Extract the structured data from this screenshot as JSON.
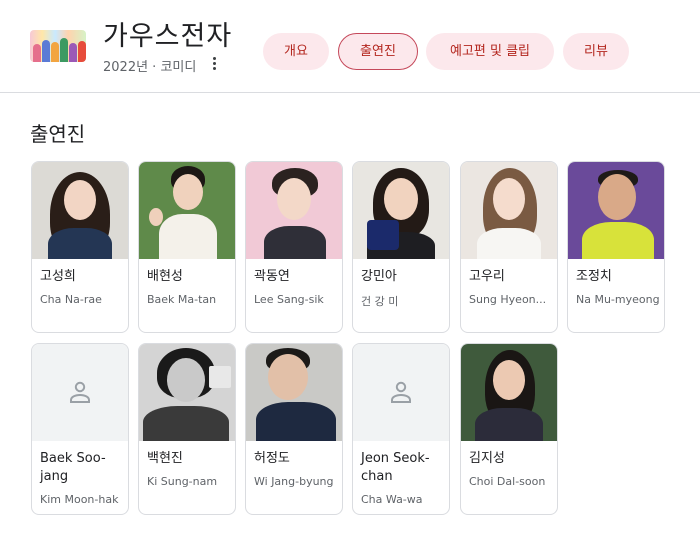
{
  "header": {
    "title": "가우스전자",
    "subtitle": "2022년 · 코미디",
    "tabs": [
      {
        "label": "개요",
        "active": false
      },
      {
        "label": "출연진",
        "active": true
      },
      {
        "label": "예고편 및 클립",
        "active": false
      },
      {
        "label": "리뷰",
        "active": false
      }
    ]
  },
  "section": {
    "title": "출연진"
  },
  "cast": [
    {
      "name": "고성희",
      "role": "Cha Na-rae",
      "photo": "photo"
    },
    {
      "name": "배현성",
      "role": "Baek Ma-tan",
      "photo": "photo"
    },
    {
      "name": "곽동연",
      "role": "Lee Sang-sik",
      "photo": "photo"
    },
    {
      "name": "강민아",
      "role": "건 강 미",
      "photo": "photo"
    },
    {
      "name": "고우리",
      "role": "Sung Hyeon...",
      "photo": "photo"
    },
    {
      "name": "조정치",
      "role": "Na Mu-myeong",
      "photo": "photo"
    },
    {
      "name": "Baek Soo-jang",
      "role": "Kim Moon-hak",
      "photo": "person-placeholder-icon"
    },
    {
      "name": "백현진",
      "role": "Ki Sung-nam",
      "photo": "photo"
    },
    {
      "name": "허정도",
      "role": "Wi Jang-byung",
      "photo": "photo"
    },
    {
      "name": "Jeon Seok-chan",
      "role": "Cha Wa-wa",
      "photo": "person-placeholder-icon"
    },
    {
      "name": "김지성",
      "role": "Choi Dal-soon",
      "photo": "photo"
    }
  ],
  "colors": {
    "chip_bg": "#fce8ec",
    "chip_text": "#b3261e",
    "chip_active_border": "#c5485a",
    "divider": "#dadce0"
  }
}
